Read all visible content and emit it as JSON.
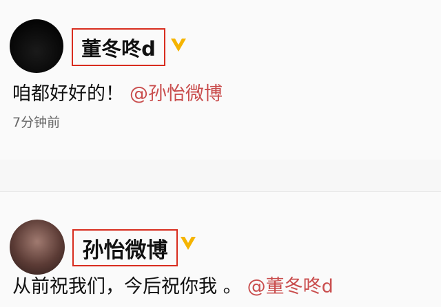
{
  "posts": [
    {
      "username": "董冬咚d",
      "text": "咱都好好的！",
      "mention": "@孙怡微博",
      "timestamp": "7分钟前",
      "verified": true,
      "avatar_icon": "user-avatar"
    },
    {
      "username": "孙怡微博",
      "text": "从前祝我们，今后祝你我 。",
      "mention": "@董冬咚d",
      "verified": true,
      "avatar_icon": "user-avatar"
    }
  ],
  "colors": {
    "highlight_border": "#d82c1e",
    "verified_badge": "#f5b400",
    "mention": "#c94d4d"
  }
}
